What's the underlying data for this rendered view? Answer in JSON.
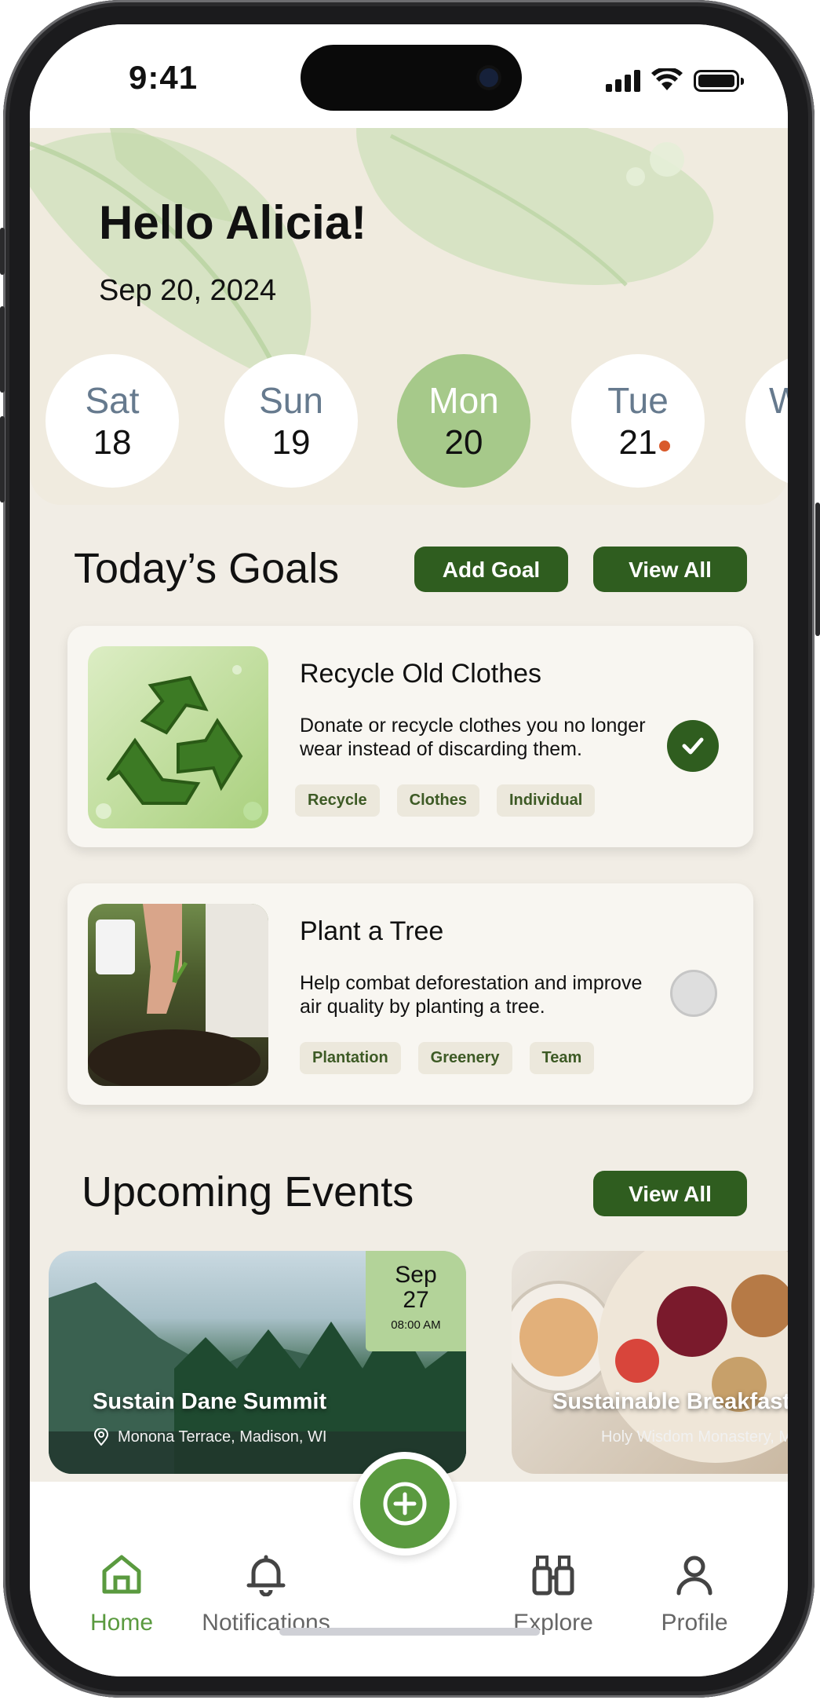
{
  "status_bar": {
    "time": "9:41"
  },
  "header": {
    "greeting": "Hello Alicia!",
    "date": "Sep 20, 2024"
  },
  "days": [
    {
      "name": "Sat",
      "num": "18",
      "active": false,
      "dot": false
    },
    {
      "name": "Sun",
      "num": "19",
      "active": false,
      "dot": false
    },
    {
      "name": "Mon",
      "num": "20",
      "active": true,
      "dot": false
    },
    {
      "name": "Tue",
      "num": "21",
      "active": false,
      "dot": true
    },
    {
      "name": "W",
      "num": "",
      "active": false,
      "dot": false
    }
  ],
  "goals": {
    "title": "Today’s Goals",
    "add_label": "Add Goal",
    "view_all_label": "View All",
    "items": [
      {
        "title": "Recycle Old Clothes",
        "desc": "Donate or recycle clothes you no longer wear instead of discarding them.",
        "tags": [
          "Recycle",
          "Clothes",
          "Individual"
        ],
        "done": true
      },
      {
        "title": "Plant a Tree",
        "desc": "Help combat deforestation and improve air quality by planting a tree.",
        "tags": [
          "Plantation",
          "Greenery",
          "Team"
        ],
        "done": false
      }
    ]
  },
  "events": {
    "title": "Upcoming Events",
    "view_all_label": "View All",
    "items": [
      {
        "title": "Sustain Dane Summit",
        "location": "Monona Terrace, Madison, WI",
        "month": "Sep",
        "day": "27",
        "time": "08:00 AM"
      },
      {
        "title": "Sustainable Breakfast",
        "location": "Holy Wisdom Monastery, Ma"
      }
    ]
  },
  "nav": {
    "items": [
      {
        "label": "Home",
        "icon": "home-icon",
        "active": true
      },
      {
        "label": "Notifications",
        "icon": "bell-icon",
        "active": false
      },
      {
        "label": "Explore",
        "icon": "binoculars-icon",
        "active": false
      },
      {
        "label": "Profile",
        "icon": "person-icon",
        "active": false
      }
    ]
  },
  "colors": {
    "accent_dark": "#2f5d1f",
    "accent_light": "#a6c98a",
    "accent_mid": "#5a9a3f",
    "dot": "#d95a2b"
  }
}
